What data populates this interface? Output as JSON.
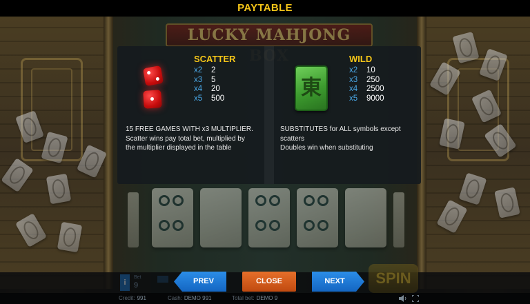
{
  "header": {
    "title": "PAYTABLE"
  },
  "game": {
    "logo_text": "LUCKY MAHJONG BOX"
  },
  "scatter": {
    "title": "SCATTER",
    "icon": "red-dice-icon",
    "payouts": [
      {
        "mult": "x2",
        "value": "2"
      },
      {
        "mult": "x3",
        "value": "5"
      },
      {
        "mult": "x4",
        "value": "20"
      },
      {
        "mult": "x5",
        "value": "500"
      }
    ],
    "description_line1": "15 FREE GAMES WITH x3 MULTIPLIER.",
    "description_line2": "Scatter wins pay total bet, multiplied by",
    "description_line3": "the multiplier displayed in the table"
  },
  "wild": {
    "title": "WILD",
    "icon": "green-mahjong-tile-icon",
    "tile_glyph": "東",
    "payouts": [
      {
        "mult": "x2",
        "value": "10"
      },
      {
        "mult": "x3",
        "value": "250"
      },
      {
        "mult": "x4",
        "value": "2500"
      },
      {
        "mult": "x5",
        "value": "9000"
      }
    ],
    "description_line1": "SUBSTITUTES for ALL symbols except",
    "description_line2": "scatters",
    "description_line3": "Doubles win when substituting"
  },
  "controls": {
    "prev_label": "PREV",
    "close_label": "CLOSE",
    "next_label": "NEXT",
    "spin_label": "SPIN",
    "bet_label": "Bet",
    "bet_value": "9",
    "info_label": "i"
  },
  "status": {
    "credit_label": "Credit:",
    "credit_value": "991",
    "cash_label": "Cash:",
    "cash_value": "DEMO 991",
    "total_bet_label": "Total bet:",
    "total_bet_value": "DEMO 9"
  },
  "colors": {
    "title_yellow": "#f5c518",
    "multiplier_blue": "#4aa8e8",
    "nav_blue": "#1e7ad6",
    "close_orange": "#d85a1c"
  }
}
